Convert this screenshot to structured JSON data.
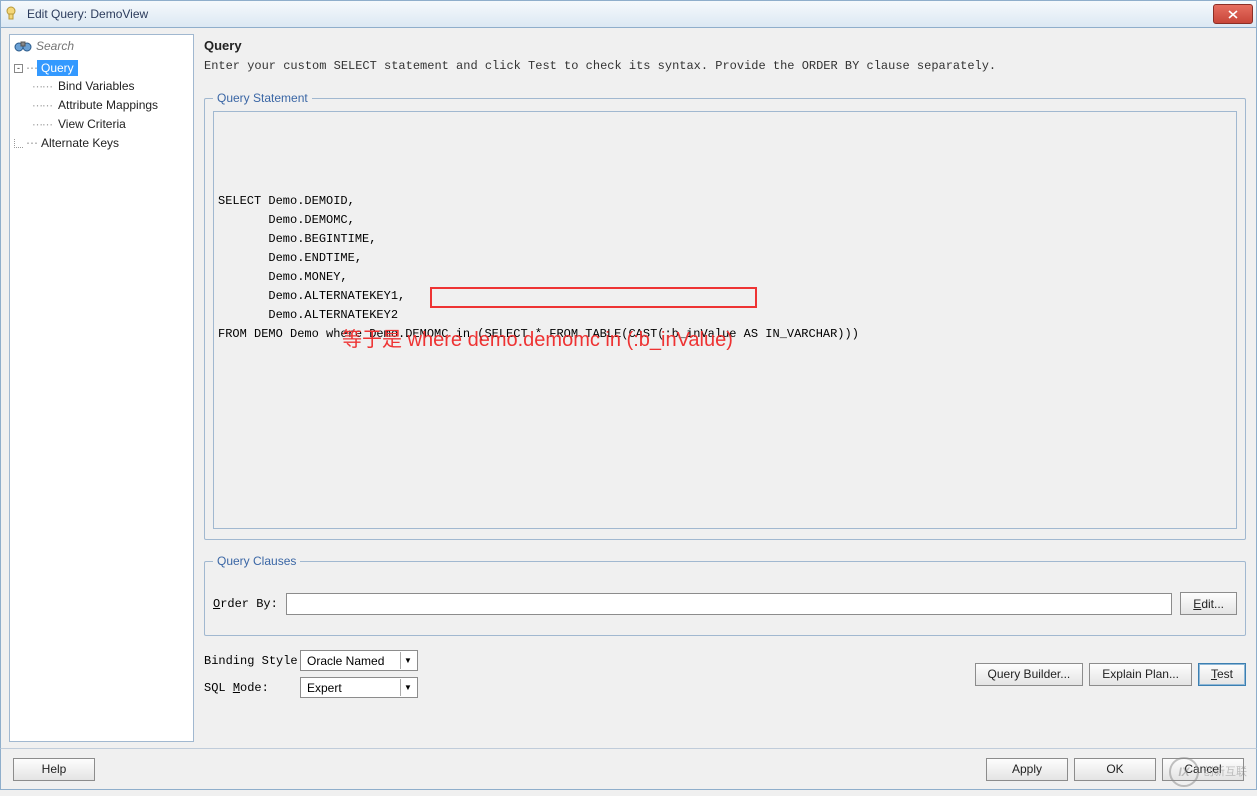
{
  "window": {
    "title": "Edit Query: DemoView"
  },
  "search": {
    "placeholder": "Search"
  },
  "tree": {
    "root": "Query",
    "children": [
      "Bind Variables",
      "Attribute Mappings",
      "View Criteria"
    ],
    "alt": "Alternate Keys"
  },
  "header": {
    "title": "Query",
    "instruction": "Enter your custom SELECT statement and click Test to check its syntax.  Provide the ORDER BY clause separately."
  },
  "queryStatement": {
    "legend": "Query Statement",
    "sql": "SELECT Demo.DEMOID,\n       Demo.DEMOMC,\n       Demo.BEGINTIME,\n       Demo.ENDTIME,\n       Demo.MONEY,\n       Demo.ALTERNATEKEY1,\n       Demo.ALTERNATEKEY2\nFROM DEMO Demo where Demo.DEMOMC in (SELECT * FROM TABLE(CAST(:b_inValue AS IN_VARCHAR)))",
    "highlighted": "(SELECT * FROM TABLE(CAST(:b_inValue AS IN_VARCHAR)))",
    "annotation": "等于是 where demo.demomc in (:b_inValue)"
  },
  "queryClauses": {
    "legend": "Query Clauses",
    "orderByLabelPre": "O",
    "orderByLabelPost": "rder By:",
    "orderByValue": "",
    "editBtn": "Edit..."
  },
  "controls": {
    "bindingStylePre": "Bindin",
    "bindingStyleU": "g",
    "bindingStylePost": " Style:",
    "bindingStyleValue": "Oracle Named",
    "sqlModePre": "SQL ",
    "sqlModeU": "M",
    "sqlModePost": "ode:",
    "sqlModeValue": "Expert",
    "queryBuilderBtn": "Query Builder...",
    "explainPlanBtn": "Explain Plan...",
    "testBtnU": "T",
    "testBtnPost": "est"
  },
  "footer": {
    "helpBtn": "Help",
    "applyBtn": "Apply",
    "okBtn": "OK",
    "cancelBtn": "Cancel"
  },
  "watermark": {
    "glyph": "IX",
    "text": "创新互联"
  }
}
